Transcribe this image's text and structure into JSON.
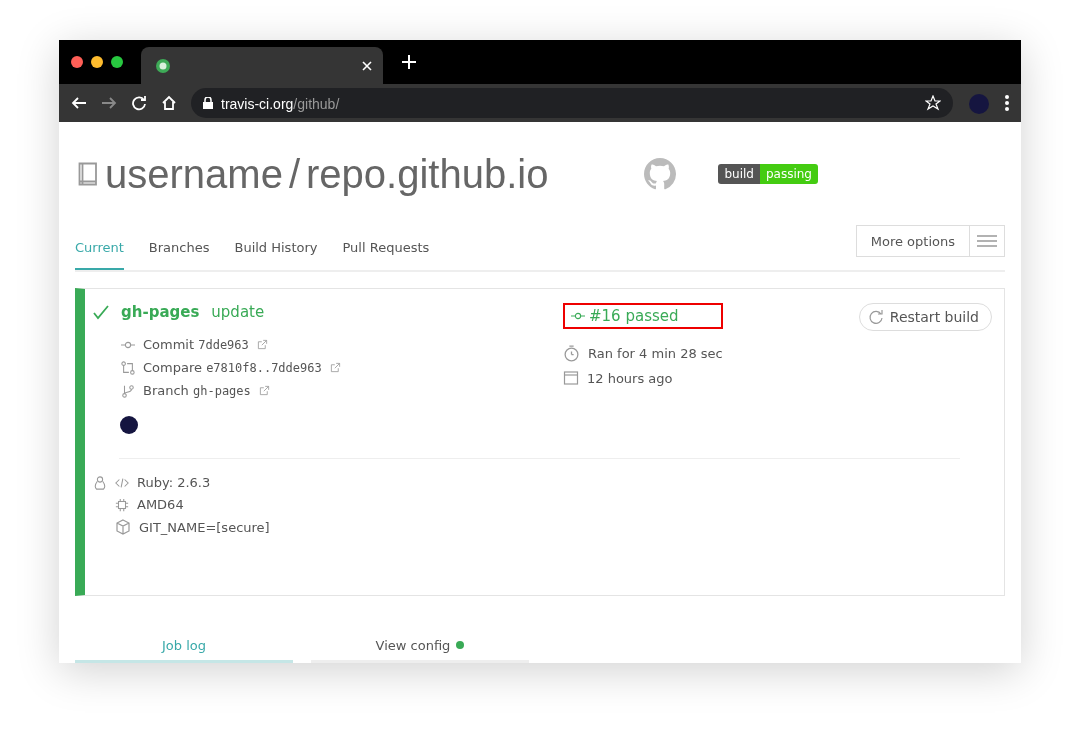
{
  "browser": {
    "url_host": "travis-ci.org",
    "url_path": "/github/"
  },
  "repo": {
    "owner": "username",
    "separator": "/",
    "name": "repo.github.io",
    "badge": {
      "label": "build",
      "status": "passing"
    }
  },
  "tabs": [
    {
      "label": "Current",
      "selected": true
    },
    {
      "label": "Branches",
      "selected": false
    },
    {
      "label": "Build History",
      "selected": false
    },
    {
      "label": "Pull Requests",
      "selected": false
    }
  ],
  "more_options": "More options",
  "build": {
    "passed": true,
    "branch": "gh-pages",
    "message": "update",
    "number_status": "#16 passed",
    "restart": "Restart build",
    "refs": [
      {
        "kind": "commit",
        "label": "Commit",
        "value": "7dde963"
      },
      {
        "kind": "compare",
        "label": "Compare",
        "value": "e7810f8..7dde963"
      },
      {
        "kind": "branch",
        "label": "Branch",
        "value": "gh-pages"
      }
    ],
    "timing": [
      {
        "kind": "duration",
        "text": "Ran for 4 min 28 sec"
      },
      {
        "kind": "date",
        "text": "12 hours ago"
      }
    ],
    "config": [
      {
        "kind": "language",
        "text": "Ruby: 2.6.3"
      },
      {
        "kind": "arch",
        "text": "AMD64"
      },
      {
        "kind": "env",
        "text": "GIT_NAME=[secure]"
      }
    ]
  },
  "job_tabs": [
    {
      "label": "Job log",
      "selected": true,
      "dot": false
    },
    {
      "label": "View config",
      "selected": false,
      "dot": true
    }
  ]
}
